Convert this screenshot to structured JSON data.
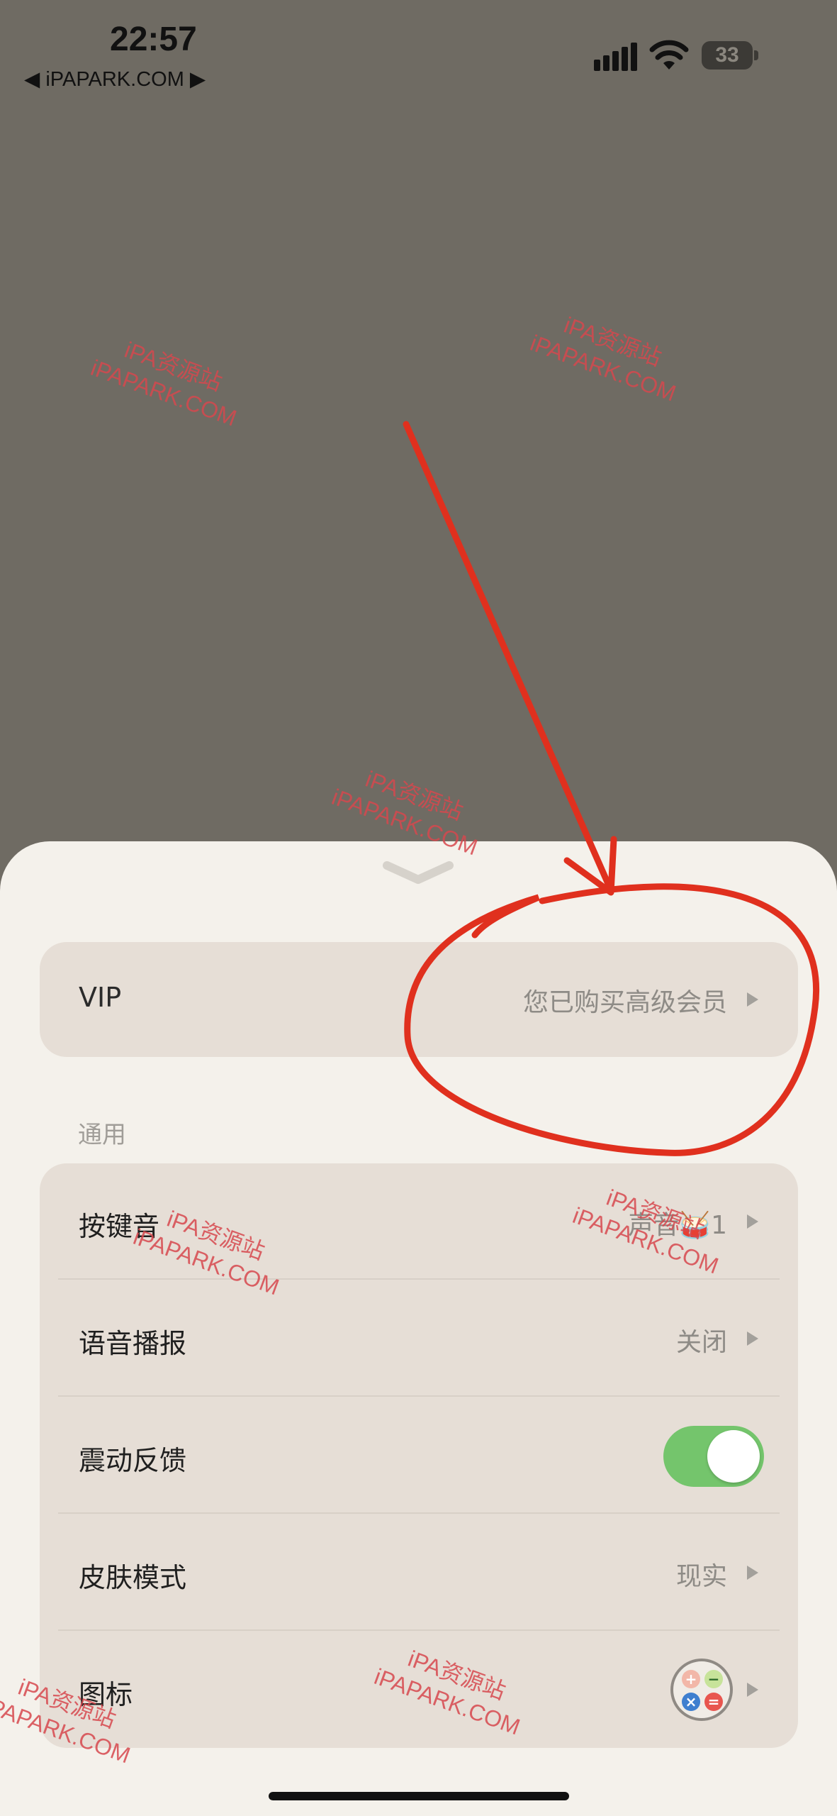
{
  "status_bar": {
    "time": "22:57",
    "back_label": "◀ iPAPARK.COM ▶",
    "battery": "33"
  },
  "sheet": {
    "vip": {
      "label": "VIP",
      "value": "您已购买高级会员"
    },
    "section_title": "通用",
    "rows": [
      {
        "label": "按键音",
        "value": "声音🥁1"
      },
      {
        "label": "语音播报",
        "value": "关闭"
      },
      {
        "label": "震动反馈",
        "toggle_on": true
      },
      {
        "label": "皮肤模式",
        "value": "现实"
      },
      {
        "label": "图标",
        "icon": "calculator-app-icon"
      }
    ]
  },
  "watermark": {
    "cn": "iPA资源站",
    "en": "iPAPARK.COM"
  },
  "colors": {
    "background": "#6f6b63",
    "sheet": "#f4f1eb",
    "card": "#e6ded6",
    "toggle_on": "#74c56c",
    "annotation_red": "#e0301e"
  }
}
